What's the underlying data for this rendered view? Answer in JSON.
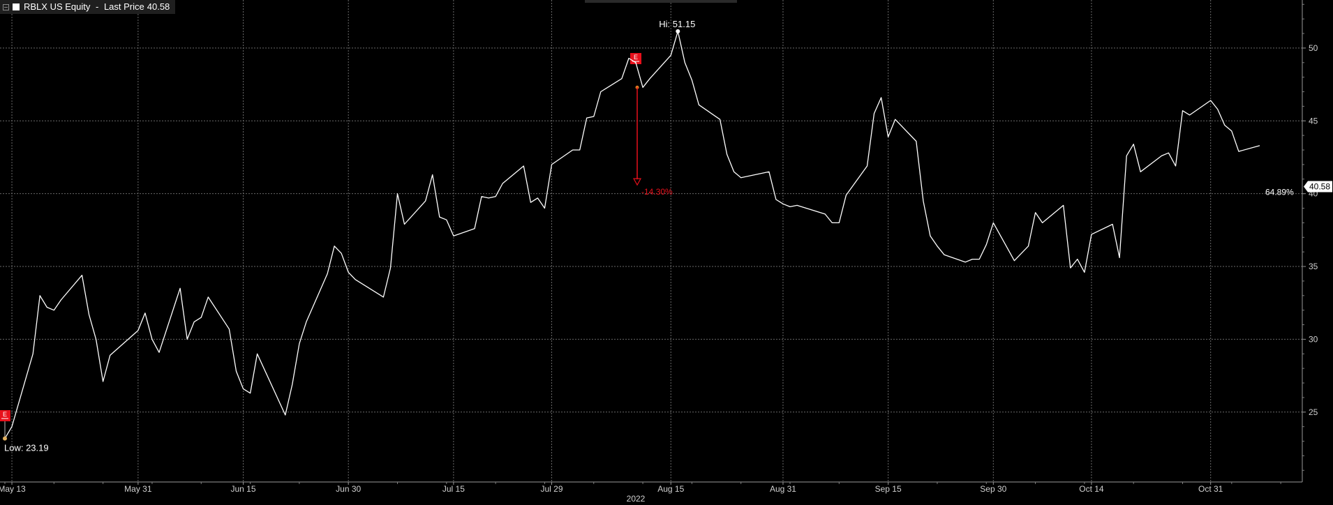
{
  "legend": {
    "series_name": "RBLX US Equity",
    "separator": " - ",
    "field": "Last Price",
    "value": "40.58"
  },
  "colors": {
    "background": "#000000",
    "line": "#ffffff",
    "grid": "#6a6a6a",
    "axis_text": "#d0d0d0",
    "event_red": "#e8101b",
    "low_marker": "#e0b060"
  },
  "chart_data": {
    "type": "line",
    "series": [
      {
        "name": "RBLX US Equity - Last Price",
        "dates": [
          "2022-05-12",
          "2022-05-13",
          "2022-05-16",
          "2022-05-17",
          "2022-05-18",
          "2022-05-19",
          "2022-05-20",
          "2022-05-23",
          "2022-05-24",
          "2022-05-25",
          "2022-05-26",
          "2022-05-27",
          "2022-05-31",
          "2022-06-01",
          "2022-06-02",
          "2022-06-03",
          "2022-06-06",
          "2022-06-07",
          "2022-06-08",
          "2022-06-09",
          "2022-06-10",
          "2022-06-13",
          "2022-06-14",
          "2022-06-15",
          "2022-06-16",
          "2022-06-17",
          "2022-06-21",
          "2022-06-22",
          "2022-06-23",
          "2022-06-24",
          "2022-06-27",
          "2022-06-28",
          "2022-06-29",
          "2022-06-30",
          "2022-07-01",
          "2022-07-05",
          "2022-07-06",
          "2022-07-07",
          "2022-07-08",
          "2022-07-11",
          "2022-07-12",
          "2022-07-13",
          "2022-07-14",
          "2022-07-15",
          "2022-07-18",
          "2022-07-19",
          "2022-07-20",
          "2022-07-21",
          "2022-07-22",
          "2022-07-25",
          "2022-07-26",
          "2022-07-27",
          "2022-07-28",
          "2022-07-29",
          "2022-08-01",
          "2022-08-02",
          "2022-08-03",
          "2022-08-04",
          "2022-08-05",
          "2022-08-08",
          "2022-08-09",
          "2022-08-10",
          "2022-08-11",
          "2022-08-12",
          "2022-08-15",
          "2022-08-16",
          "2022-08-17",
          "2022-08-18",
          "2022-08-19",
          "2022-08-22",
          "2022-08-23",
          "2022-08-24",
          "2022-08-25",
          "2022-08-26",
          "2022-08-29",
          "2022-08-30",
          "2022-08-31",
          "2022-09-01",
          "2022-09-02",
          "2022-09-06",
          "2022-09-07",
          "2022-09-08",
          "2022-09-09",
          "2022-09-12",
          "2022-09-13",
          "2022-09-14",
          "2022-09-15",
          "2022-09-16",
          "2022-09-19",
          "2022-09-20",
          "2022-09-21",
          "2022-09-22",
          "2022-09-23",
          "2022-09-26",
          "2022-09-27",
          "2022-09-28",
          "2022-09-29",
          "2022-09-30",
          "2022-10-03",
          "2022-10-04",
          "2022-10-05",
          "2022-10-06",
          "2022-10-07",
          "2022-10-10",
          "2022-10-11",
          "2022-10-12",
          "2022-10-13",
          "2022-10-14",
          "2022-10-17",
          "2022-10-18",
          "2022-10-19",
          "2022-10-20",
          "2022-10-21",
          "2022-10-24",
          "2022-10-25",
          "2022-10-26",
          "2022-10-27",
          "2022-10-28",
          "2022-10-31",
          "2022-11-01",
          "2022-11-02",
          "2022-11-03",
          "2022-11-04",
          "2022-11-07"
        ],
        "values": [
          23.19,
          24.0,
          29.0,
          33.0,
          32.2,
          32.0,
          32.7,
          34.4,
          31.7,
          30.0,
          27.1,
          28.9,
          30.6,
          31.8,
          30.0,
          29.1,
          33.5,
          30.0,
          31.2,
          31.5,
          32.9,
          30.7,
          27.8,
          26.6,
          26.3,
          29.0,
          24.8,
          26.9,
          29.7,
          31.2,
          34.5,
          36.4,
          35.9,
          34.6,
          34.1,
          32.9,
          34.9,
          40.0,
          37.9,
          39.5,
          41.3,
          38.4,
          38.2,
          37.1,
          37.6,
          39.8,
          39.7,
          39.8,
          40.7,
          41.9,
          39.4,
          39.7,
          39.0,
          42.0,
          43.0,
          43.0,
          45.2,
          45.3,
          47.0,
          47.9,
          49.3,
          49.0,
          47.3,
          47.9,
          49.5,
          51.15,
          49.0,
          47.8,
          46.1,
          45.1,
          42.7,
          41.5,
          41.1,
          41.2,
          41.5,
          39.6,
          39.3,
          39.1,
          39.2,
          38.6,
          38.0,
          38.0,
          39.9,
          41.9,
          45.5,
          46.6,
          43.9,
          45.1,
          43.6,
          39.5,
          37.1,
          36.4,
          35.8,
          35.3,
          35.5,
          35.5,
          36.5,
          38.0,
          35.4,
          35.9,
          36.4,
          38.7,
          38.0,
          39.2,
          34.9,
          35.5,
          34.6,
          37.2,
          37.9,
          35.6,
          42.6,
          43.4,
          41.5,
          42.6,
          42.8,
          41.9,
          45.7,
          45.4,
          46.4,
          45.8,
          44.7,
          44.3,
          42.9,
          43.3,
          40.58
        ]
      }
    ],
    "x_ticks": [
      "May 13",
      "May 31",
      "Jun 15",
      "Jun 30",
      "Jul 15",
      "Jul 29",
      "Aug 15",
      "Aug 31",
      "Sep 15",
      "Sep 30",
      "Oct 14",
      "Oct 31"
    ],
    "x_year_label": "2022",
    "y_ticks": [
      25,
      30,
      35,
      40,
      45,
      50
    ],
    "ylim": [
      20.2,
      53.3
    ],
    "grid": true,
    "annotations": {
      "high": {
        "label": "Hi: 51.15",
        "value": 51.15
      },
      "low": {
        "label": "Low: 23.19",
        "value": 23.19
      },
      "last_value_tag": "40.58",
      "pct_change": "64.89%",
      "earnings_markers": [
        {
          "label": "E",
          "date": "2022-05-12"
        },
        {
          "label": "E",
          "date": "2022-08-10"
        }
      ],
      "earnings_move": {
        "label": "-14.30%",
        "from_value": 47.3,
        "to_value": 40.6
      }
    }
  }
}
